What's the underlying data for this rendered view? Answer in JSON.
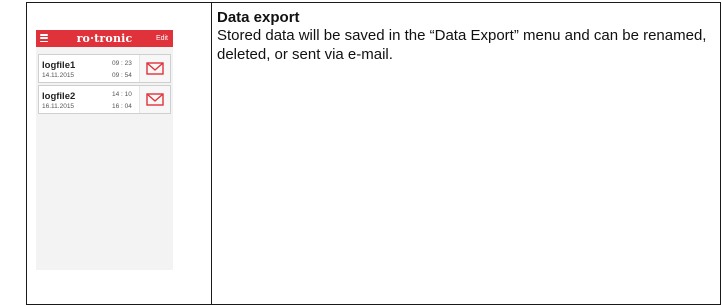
{
  "app": {
    "brand": "ro·tronic",
    "edit_label": "Edit",
    "accent_color": "#e0323a",
    "files": [
      {
        "name": "logfile1",
        "date": "14.11.2015",
        "time_start": "09 : 23",
        "time_end": "09 : 54"
      },
      {
        "name": "logfile2",
        "date": "16.11.2015",
        "time_start": "14 : 10",
        "time_end": "16 : 04"
      }
    ],
    "icons": {
      "menu": "menu-icon",
      "mail": "mail-icon"
    }
  },
  "section": {
    "title": "Data export",
    "body": "Stored data will be saved in the “Data Export” menu and can be renamed, deleted, or sent via e-mail."
  }
}
